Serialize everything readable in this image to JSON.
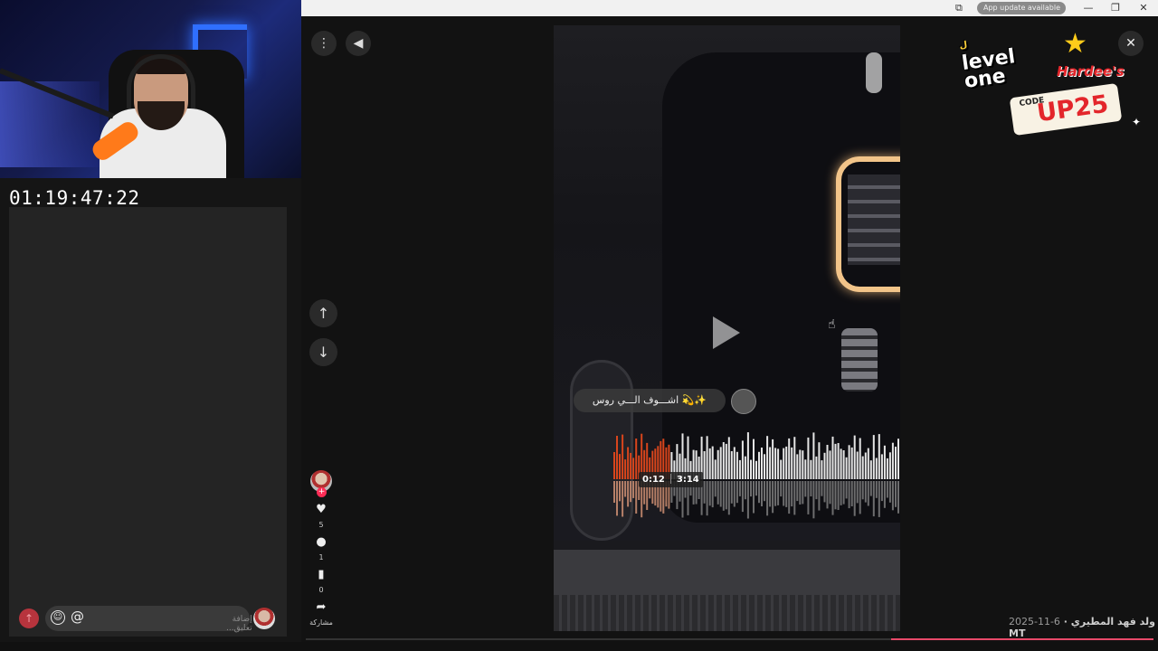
{
  "stream": {
    "timer": "01:19:47:22"
  },
  "browser": {
    "update_label": "App update available",
    "update_menu": "⋮",
    "extension_icon": "puzzle-icon",
    "minimize": "—",
    "restore": "❐",
    "close": "✕"
  },
  "viewer": {
    "more_glyph": "⋮",
    "volume_glyph": "◀",
    "up_glyph": "↑",
    "down_glyph": "↓",
    "close_glyph": "✕",
    "song_text": "✨💫 اشـــوف الـــي روس",
    "time_current": "0:12",
    "time_total": "3:14",
    "author": "ولد فهد المطيري MT",
    "date": "2025-11-6",
    "progress_fraction": 0.31
  },
  "actions": {
    "follow_plus": "+",
    "likes": "5",
    "comments": "1",
    "saves": "0",
    "share_label": "مشاركة",
    "like_icon": "♥",
    "comment_icon": "●",
    "save_icon": "▮",
    "share_icon": "➦"
  },
  "comment_box": {
    "placeholder": "إضافة تعليق...",
    "send_glyph": "↑",
    "emoji_glyph": "☺",
    "mention_glyph": "@"
  },
  "sponsor": {
    "level_logo": "level one",
    "level_sub": "ل",
    "brand": "Hardee's",
    "code_label": "CODE",
    "code_value": "UP25",
    "star_glyph": "★",
    "sparkle_glyph": "✦"
  }
}
